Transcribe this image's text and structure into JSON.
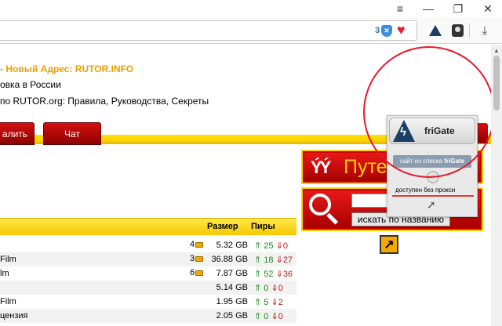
{
  "browser": {
    "minimize": "—",
    "restore": "❐",
    "close": "✕",
    "menu_icon": "≡",
    "bookmarks_icon": "▤",
    "badge_count": "3",
    "shield_letter": "✕",
    "heart": "♥",
    "download_icon": "⤓"
  },
  "page": {
    "news_title": "- Новый Адрес: RUTOR.INFO",
    "news_lines": [
      "овка в России",
      "по RUTOR.org: Правила, Руководства, Секреты"
    ],
    "nav_tabs": [
      "алить",
      "Чат"
    ],
    "table": {
      "headers": {
        "size": "Размер",
        "peers": "Пиры"
      },
      "rows": [
        {
          "name": "",
          "comments": "4",
          "size": "5.32 GB",
          "seeds": "25",
          "leechers": "0"
        },
        {
          "name": "Film",
          "comments": "3",
          "size": "36.88 GB",
          "seeds": "18",
          "leechers": "27"
        },
        {
          "name": "lm",
          "comments": "6",
          "size": "7.87 GB",
          "seeds": "52",
          "leechers": "36"
        },
        {
          "name": "",
          "comments": "",
          "size": "5.14 GB",
          "seeds": "0",
          "leechers": "0"
        },
        {
          "name": "Film",
          "comments": "",
          "size": "1.95 GB",
          "seeds": "5",
          "leechers": "2"
        },
        {
          "name": "цензия",
          "comments": "",
          "size": "2.05 GB",
          "seeds": "0",
          "leechers": "0"
        }
      ]
    },
    "guide_text": "Путеводитель",
    "search": {
      "input_value": "",
      "button_label": "искать по названию",
      "arrow": "↗"
    }
  },
  "popup": {
    "title": "friGate",
    "list_button_prefix": "сайт из списка ",
    "list_button_brand": "friGate",
    "status": "доступен без прокси",
    "power_icon": "⏻",
    "arrow_icon": "➚"
  }
}
